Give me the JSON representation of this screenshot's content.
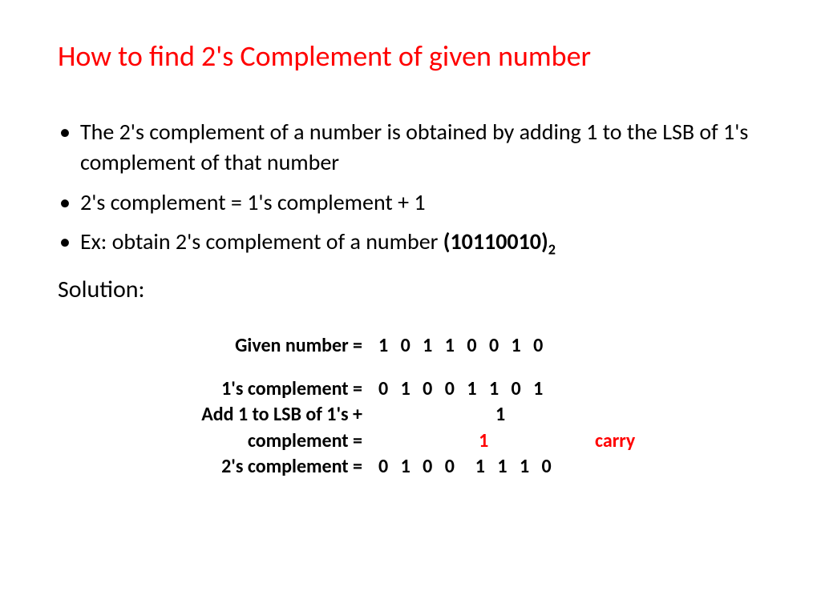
{
  "title": "How to find 2's Complement of given number",
  "bullets": [
    "The 2's complement of a number is obtained by adding 1 to the LSB of 1's complement of that number",
    "2's complement = 1's complement + 1"
  ],
  "ex_prefix": "Ex: obtain 2's complement of a number ",
  "ex_number": "(10110010)",
  "ex_subscript": "2",
  "solution_label": "Solution:",
  "calc": {
    "given_label": "Given number =",
    "given_value": "1 0 1 1 0 0 1 0",
    "ones_label": "1's complement =",
    "ones_value": "0 1 0 0 1 1 0 1",
    "add_label_1": "Add 1 to LSB of 1's    +",
    "add_value": "              1",
    "complement_label": "complement =",
    "carry_value": "            1",
    "carry_label": "carry",
    "twos_label": "2's complement =",
    "twos_value": "0 1 0 0  1 1 1 0"
  }
}
